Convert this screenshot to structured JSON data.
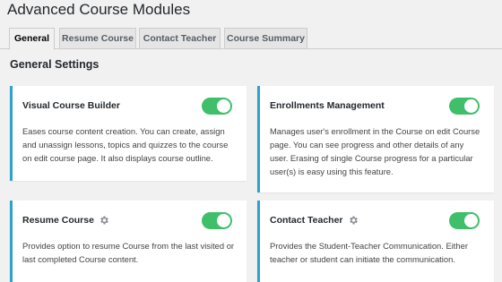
{
  "page": {
    "title": "Advanced Course Modules"
  },
  "tabs": [
    {
      "label": "General",
      "active": true
    },
    {
      "label": "Resume Course",
      "active": false
    },
    {
      "label": "Contact Teacher",
      "active": false
    },
    {
      "label": "Course Summary",
      "active": false
    }
  ],
  "section": {
    "title": "General Settings"
  },
  "cards": [
    {
      "title": "Visual Course Builder",
      "description": "Eases course content creation. You can create, assign and unassign lessons, topics and quizzes to the course on edit course page. It also displays course outline.",
      "enabled": true,
      "has_settings_icon": false
    },
    {
      "title": "Enrollments Management",
      "description": "Manages user's enrollment in the Course on edit Course page. You can see progress and other details of any user. Erasing of single Course progress for a particular user(s) is easy using this feature.",
      "enabled": true,
      "has_settings_icon": false
    },
    {
      "title": "Resume Course",
      "description": "Provides option to resume Course from the last visited or last completed Course content.",
      "enabled": true,
      "has_settings_icon": true
    },
    {
      "title": "Contact Teacher",
      "description": "Provides the Student-Teacher Communication. Either teacher or student can initiate the communication.",
      "enabled": true,
      "has_settings_icon": true
    }
  ],
  "colors": {
    "accent": "#2ea2cc",
    "toggle_on": "#3fbf6a",
    "background": "#f1f1f1"
  }
}
